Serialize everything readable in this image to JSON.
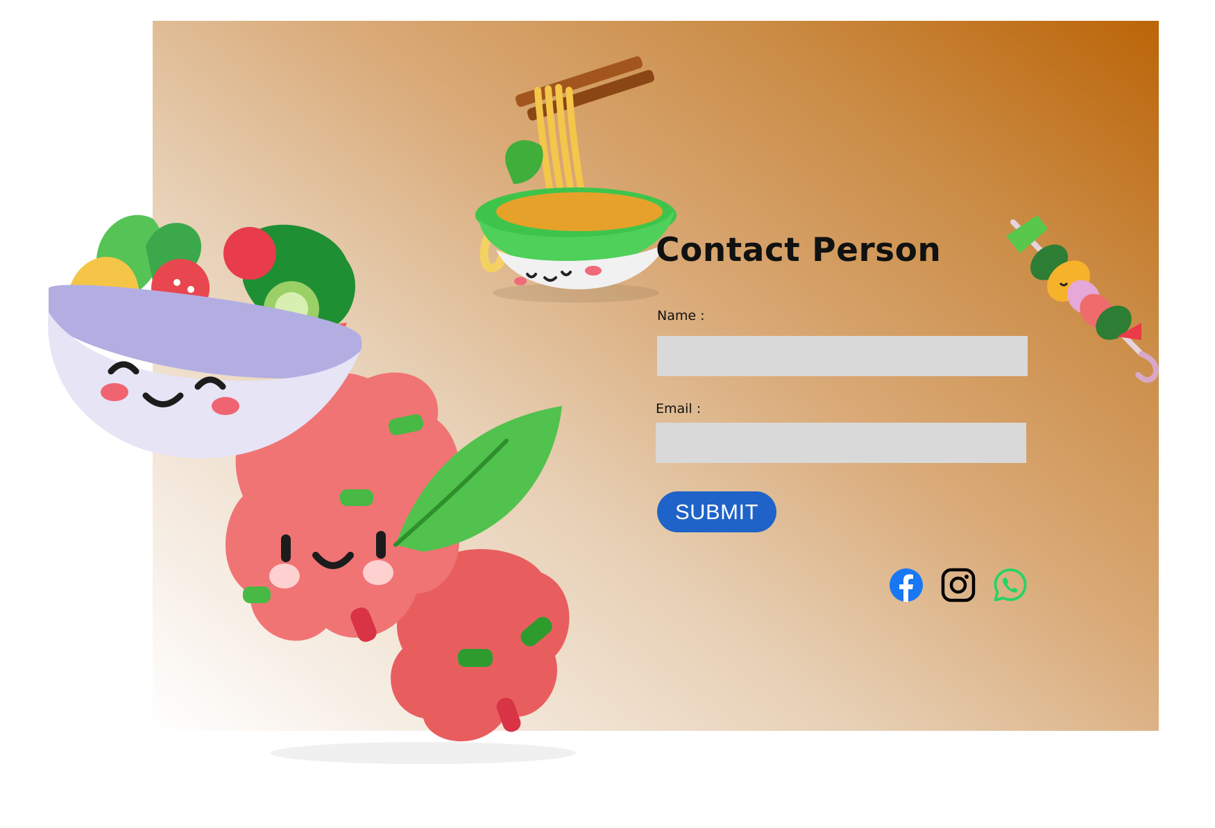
{
  "contact": {
    "title": "Contact Person",
    "name_label": "Name :",
    "name_value": "",
    "email_label": "Email :",
    "email_value": "",
    "submit_label": "SUBMIT"
  },
  "social": [
    {
      "icon": "facebook-icon",
      "color": "#1877f2"
    },
    {
      "icon": "instagram-icon",
      "color": "#000000"
    },
    {
      "icon": "whatsapp-icon",
      "color": "#25d366"
    }
  ],
  "colors": {
    "accent": "#1f63c8",
    "input_bg": "#d9d9d9",
    "gradient_dark": "#bb6508",
    "gradient_light": "#f1e3d3"
  },
  "illustrations": [
    "noodle-bowl-illustration",
    "salad-bowl-illustration",
    "meatball-illustration",
    "skewer-illustration"
  ]
}
